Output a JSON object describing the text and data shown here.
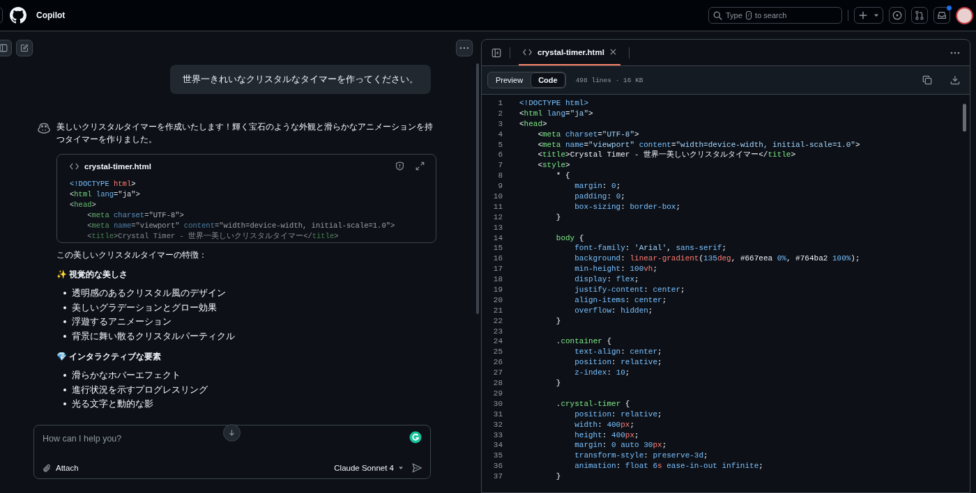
{
  "header": {
    "title": "Copilot",
    "search": {
      "placeholder_before": "Type",
      "shortcut_key": "/",
      "placeholder_after": "to search"
    },
    "notification_unread": true
  },
  "chat": {
    "user_message": "世界一きれいなクリスタルなタイマーを作ってください。",
    "assistant_intro": "美しいクリスタルタイマーを作成いたします！輝く宝石のような外観と滑らかなアニメーションを持つタイマーを作りました。",
    "code_card": {
      "filename": "crystal-timer.html",
      "lines": [
        [
          {
            "kind": "doctype",
            "text": "<!DOCTYPE "
          },
          {
            "kind": "keyword",
            "text": "html"
          },
          {
            "kind": "punct",
            "text": ">"
          }
        ],
        [
          {
            "kind": "punct",
            "text": "<"
          },
          {
            "kind": "tag",
            "text": "html"
          },
          {
            "kind": "attr",
            "text": " lang"
          },
          {
            "kind": "punct",
            "text": "=\"ja\">"
          }
        ],
        [
          {
            "kind": "punct",
            "text": "<"
          },
          {
            "kind": "tag",
            "text": "head"
          },
          {
            "kind": "punct",
            "text": ">"
          }
        ],
        [
          {
            "kind": "punct",
            "text": "    <"
          },
          {
            "kind": "tag",
            "text": "meta"
          },
          {
            "kind": "attr",
            "text": " charset"
          },
          {
            "kind": "punct",
            "text": "=\"UTF-8\">"
          }
        ],
        [
          {
            "kind": "punct",
            "text": "    <"
          },
          {
            "kind": "tag",
            "text": "meta"
          },
          {
            "kind": "attr",
            "text": " name"
          },
          {
            "kind": "punct",
            "text": "=\"viewport\""
          },
          {
            "kind": "attr",
            "text": " content"
          },
          {
            "kind": "punct",
            "text": "=\"width=device-width, initial-scale=1.0\">"
          }
        ],
        [
          {
            "kind": "punct",
            "text": "    <"
          },
          {
            "kind": "tag",
            "text": "title"
          },
          {
            "kind": "punct",
            "text": ">Crystal Timer - 世界一美しいクリスタルタイマー</"
          },
          {
            "kind": "tag",
            "text": "title"
          },
          {
            "kind": "punct",
            "text": ">"
          }
        ]
      ]
    },
    "features_intro": "この美しいクリスタルタイマーの特徴：",
    "sections": [
      {
        "heading": "✨ 視覚的な美しさ",
        "items": [
          "透明感のあるクリスタル風のデザイン",
          "美しいグラデーションとグロー効果",
          "浮遊するアニメーション",
          "背景に舞い散るクリスタルパーティクル"
        ]
      },
      {
        "heading": "💎 インタラクティブな要素",
        "items": [
          "滑らかなホバーエフェクト",
          "進行状況を示すプログレスリング",
          "光る文字と動的な影"
        ]
      }
    ],
    "input": {
      "placeholder": "How can I help you?",
      "attach_label": "Attach",
      "model": "Claude Sonnet 4"
    }
  },
  "file_panel": {
    "tab": "crystal-timer.html",
    "views": [
      {
        "label": "Preview",
        "selected": false
      },
      {
        "label": "Code",
        "selected": true
      }
    ],
    "info": "498 lines · 16 KB",
    "lines": [
      {
        "num": "1",
        "tokens": [
          {
            "kind": "value",
            "text": "<!DOCTYPE html>"
          }
        ]
      },
      {
        "num": "2",
        "tokens": [
          {
            "kind": "punct",
            "text": "<"
          },
          {
            "kind": "tag",
            "text": "html"
          },
          {
            "kind": "attr",
            "text": " lang"
          },
          {
            "kind": "punct",
            "text": "="
          },
          {
            "kind": "string",
            "text": "\"ja\""
          },
          {
            "kind": "punct",
            "text": ">"
          }
        ]
      },
      {
        "num": "3",
        "tokens": [
          {
            "kind": "punct",
            "text": "<"
          },
          {
            "kind": "tag",
            "text": "head"
          },
          {
            "kind": "punct",
            "text": ">"
          }
        ]
      },
      {
        "num": "4",
        "tokens": [
          {
            "kind": "punct",
            "text": "    <"
          },
          {
            "kind": "tag",
            "text": "meta"
          },
          {
            "kind": "attr",
            "text": " charset"
          },
          {
            "kind": "punct",
            "text": "="
          },
          {
            "kind": "string",
            "text": "\"UTF-8\""
          },
          {
            "kind": "punct",
            "text": ">"
          }
        ]
      },
      {
        "num": "5",
        "tokens": [
          {
            "kind": "punct",
            "text": "    <"
          },
          {
            "kind": "tag",
            "text": "meta"
          },
          {
            "kind": "attr",
            "text": " name"
          },
          {
            "kind": "punct",
            "text": "="
          },
          {
            "kind": "string",
            "text": "\"viewport\""
          },
          {
            "kind": "attr",
            "text": " content"
          },
          {
            "kind": "punct",
            "text": "="
          },
          {
            "kind": "string",
            "text": "\"width=device-width, initial-scale=1.0\""
          },
          {
            "kind": "punct",
            "text": ">"
          }
        ]
      },
      {
        "num": "6",
        "tokens": [
          {
            "kind": "punct",
            "text": "    <"
          },
          {
            "kind": "tag",
            "text": "title"
          },
          {
            "kind": "punct",
            "text": ">Crystal Timer - 世界一美しいクリスタルタイマー</"
          },
          {
            "kind": "tag",
            "text": "title"
          },
          {
            "kind": "punct",
            "text": ">"
          }
        ]
      },
      {
        "num": "7",
        "tokens": [
          {
            "kind": "punct",
            "text": "    <"
          },
          {
            "kind": "tag",
            "text": "style"
          },
          {
            "kind": "punct",
            "text": ">"
          }
        ]
      },
      {
        "num": "8",
        "tokens": [
          {
            "kind": "punct",
            "text": "        * {"
          }
        ]
      },
      {
        "num": "9",
        "tokens": [
          {
            "kind": "prop",
            "text": "            margin"
          },
          {
            "kind": "punct",
            "text": ": "
          },
          {
            "kind": "value",
            "text": "0"
          },
          {
            "kind": "punct",
            "text": ";"
          }
        ]
      },
      {
        "num": "10",
        "tokens": [
          {
            "kind": "prop",
            "text": "            padding"
          },
          {
            "kind": "punct",
            "text": ": "
          },
          {
            "kind": "value",
            "text": "0"
          },
          {
            "kind": "punct",
            "text": ";"
          }
        ]
      },
      {
        "num": "11",
        "tokens": [
          {
            "kind": "prop",
            "text": "            box-sizing"
          },
          {
            "kind": "punct",
            "text": ": "
          },
          {
            "kind": "value",
            "text": "border-box"
          },
          {
            "kind": "punct",
            "text": ";"
          }
        ]
      },
      {
        "num": "12",
        "tokens": [
          {
            "kind": "punct",
            "text": "        }"
          }
        ]
      },
      {
        "num": "13"
      },
      {
        "num": "14",
        "tokens": [
          {
            "kind": "tag",
            "text": "        body"
          },
          {
            "kind": "punct",
            "text": " {"
          }
        ]
      },
      {
        "num": "15",
        "tokens": [
          {
            "kind": "prop",
            "text": "            font-family"
          },
          {
            "kind": "punct",
            "text": ": "
          },
          {
            "kind": "string",
            "text": "'Arial'"
          },
          {
            "kind": "punct",
            "text": ", "
          },
          {
            "kind": "value",
            "text": "sans-serif"
          },
          {
            "kind": "punct",
            "text": ";"
          }
        ]
      },
      {
        "num": "16",
        "tokens": [
          {
            "kind": "prop",
            "text": "            background"
          },
          {
            "kind": "punct",
            "text": ": "
          },
          {
            "kind": "keyword",
            "text": "linear-gradient"
          },
          {
            "kind": "punct",
            "text": "("
          },
          {
            "kind": "value",
            "text": "135"
          },
          {
            "kind": "keyword",
            "text": "deg"
          },
          {
            "kind": "punct",
            "text": ", #667eea "
          },
          {
            "kind": "value",
            "text": "0%"
          },
          {
            "kind": "punct",
            "text": ", #764ba2 "
          },
          {
            "kind": "value",
            "text": "100%"
          },
          {
            "kind": "punct",
            "text": ");"
          }
        ]
      },
      {
        "num": "17",
        "tokens": [
          {
            "kind": "prop",
            "text": "            min-height"
          },
          {
            "kind": "punct",
            "text": ": "
          },
          {
            "kind": "value",
            "text": "100"
          },
          {
            "kind": "keyword",
            "text": "vh"
          },
          {
            "kind": "punct",
            "text": ";"
          }
        ]
      },
      {
        "num": "18",
        "tokens": [
          {
            "kind": "prop",
            "text": "            display"
          },
          {
            "kind": "punct",
            "text": ": "
          },
          {
            "kind": "value",
            "text": "flex"
          },
          {
            "kind": "punct",
            "text": ";"
          }
        ]
      },
      {
        "num": "19",
        "tokens": [
          {
            "kind": "prop",
            "text": "            justify-content"
          },
          {
            "kind": "punct",
            "text": ": "
          },
          {
            "kind": "value",
            "text": "center"
          },
          {
            "kind": "punct",
            "text": ";"
          }
        ]
      },
      {
        "num": "20",
        "tokens": [
          {
            "kind": "prop",
            "text": "            align-items"
          },
          {
            "kind": "punct",
            "text": ": "
          },
          {
            "kind": "value",
            "text": "center"
          },
          {
            "kind": "punct",
            "text": ";"
          }
        ]
      },
      {
        "num": "21",
        "tokens": [
          {
            "kind": "prop",
            "text": "            overflow"
          },
          {
            "kind": "punct",
            "text": ": "
          },
          {
            "kind": "value",
            "text": "hidden"
          },
          {
            "kind": "punct",
            "text": ";"
          }
        ]
      },
      {
        "num": "22",
        "tokens": [
          {
            "kind": "punct",
            "text": "        }"
          }
        ]
      },
      {
        "num": "23"
      },
      {
        "num": "24",
        "tokens": [
          {
            "kind": "punct",
            "text": "        ."
          },
          {
            "kind": "tag",
            "text": "container"
          },
          {
            "kind": "punct",
            "text": " {"
          }
        ]
      },
      {
        "num": "25",
        "tokens": [
          {
            "kind": "prop",
            "text": "            text-align"
          },
          {
            "kind": "punct",
            "text": ": "
          },
          {
            "kind": "value",
            "text": "center"
          },
          {
            "kind": "punct",
            "text": ";"
          }
        ]
      },
      {
        "num": "26",
        "tokens": [
          {
            "kind": "prop",
            "text": "            position"
          },
          {
            "kind": "punct",
            "text": ": "
          },
          {
            "kind": "value",
            "text": "relative"
          },
          {
            "kind": "punct",
            "text": ";"
          }
        ]
      },
      {
        "num": "27",
        "tokens": [
          {
            "kind": "prop",
            "text": "            z-index"
          },
          {
            "kind": "punct",
            "text": ": "
          },
          {
            "kind": "value",
            "text": "10"
          },
          {
            "kind": "punct",
            "text": ";"
          }
        ]
      },
      {
        "num": "28",
        "tokens": [
          {
            "kind": "punct",
            "text": "        }"
          }
        ]
      },
      {
        "num": "29"
      },
      {
        "num": "30",
        "tokens": [
          {
            "kind": "punct",
            "text": "        ."
          },
          {
            "kind": "tag",
            "text": "crystal-timer"
          },
          {
            "kind": "punct",
            "text": " {"
          }
        ]
      },
      {
        "num": "31",
        "tokens": [
          {
            "kind": "prop",
            "text": "            position"
          },
          {
            "kind": "punct",
            "text": ": "
          },
          {
            "kind": "value",
            "text": "relative"
          },
          {
            "kind": "punct",
            "text": ";"
          }
        ]
      },
      {
        "num": "32",
        "tokens": [
          {
            "kind": "prop",
            "text": "            width"
          },
          {
            "kind": "punct",
            "text": ": "
          },
          {
            "kind": "value",
            "text": "400"
          },
          {
            "kind": "keyword",
            "text": "px"
          },
          {
            "kind": "punct",
            "text": ";"
          }
        ]
      },
      {
        "num": "33",
        "tokens": [
          {
            "kind": "prop",
            "text": "            height"
          },
          {
            "kind": "punct",
            "text": ": "
          },
          {
            "kind": "value",
            "text": "400"
          },
          {
            "kind": "keyword",
            "text": "px"
          },
          {
            "kind": "punct",
            "text": ";"
          }
        ]
      },
      {
        "num": "34",
        "tokens": [
          {
            "kind": "prop",
            "text": "            margin"
          },
          {
            "kind": "punct",
            "text": ": "
          },
          {
            "kind": "value",
            "text": "0 auto 30"
          },
          {
            "kind": "keyword",
            "text": "px"
          },
          {
            "kind": "punct",
            "text": ";"
          }
        ]
      },
      {
        "num": "35",
        "tokens": [
          {
            "kind": "prop",
            "text": "            transform-style"
          },
          {
            "kind": "punct",
            "text": ": "
          },
          {
            "kind": "value",
            "text": "preserve-3d"
          },
          {
            "kind": "punct",
            "text": ";"
          }
        ]
      },
      {
        "num": "36",
        "tokens": [
          {
            "kind": "prop",
            "text": "            animation"
          },
          {
            "kind": "punct",
            "text": ": "
          },
          {
            "kind": "value",
            "text": "float 6"
          },
          {
            "kind": "keyword",
            "text": "s"
          },
          {
            "kind": "value",
            "text": " ease-in-out infinite"
          },
          {
            "kind": "punct",
            "text": ";"
          }
        ]
      },
      {
        "num": "37",
        "tokens": [
          {
            "kind": "punct",
            "text": "        }"
          }
        ]
      }
    ]
  }
}
